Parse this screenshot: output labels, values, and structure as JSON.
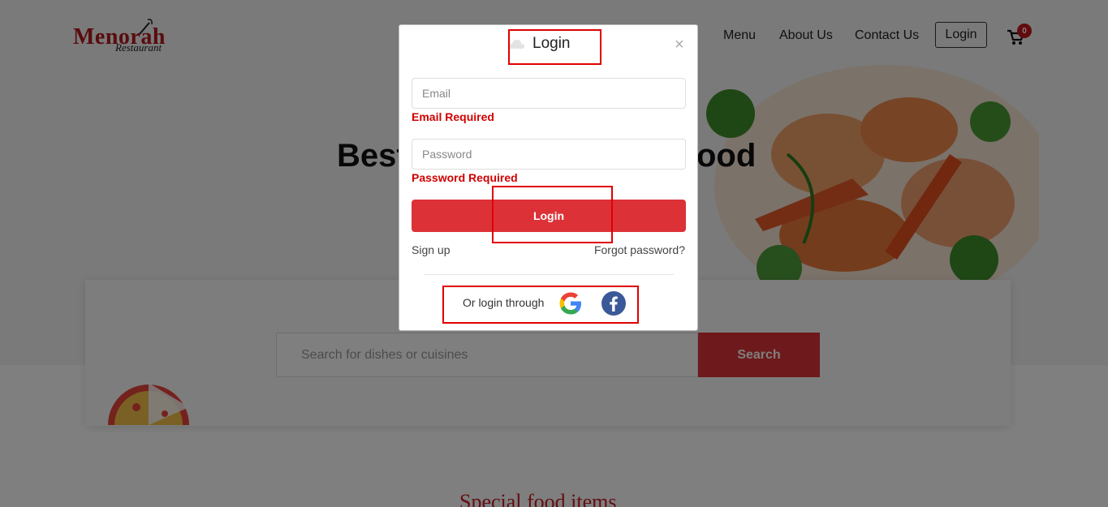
{
  "brand": {
    "logo_text": "Menorah",
    "logo_subtext": "Restaurant"
  },
  "nav": {
    "menu": "Menu",
    "about": "About Us",
    "contact": "Contact Us",
    "login": "Login",
    "cart_count": "0"
  },
  "hero": {
    "title_start": "Best",
    "title_end": "ood"
  },
  "search": {
    "placeholder": "Search for dishes or cuisines",
    "button": "Search"
  },
  "section": {
    "special_heading": "Special food items"
  },
  "modal": {
    "title": "Login",
    "close": "×",
    "email_placeholder": "Email",
    "email_error": "Email Required",
    "password_placeholder": "Password",
    "password_error": "Password Required",
    "login_button": "Login",
    "signup": "Sign up",
    "forgot": "Forgot password?",
    "social_label": "Or login through"
  },
  "colors": {
    "accent": "#dc3237",
    "error": "#d10000",
    "highlight": "#e00000"
  }
}
